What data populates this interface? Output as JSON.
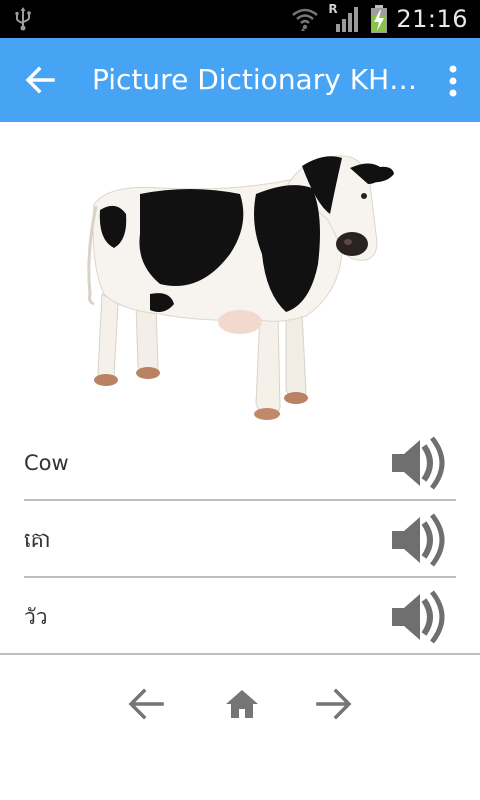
{
  "status_bar": {
    "time": "21:16",
    "icons": [
      "usb-icon",
      "wifi-icon",
      "roaming-indicator",
      "signal-icon",
      "battery-charging-icon"
    ],
    "roaming_label": "R"
  },
  "app_bar": {
    "title": "Picture Dictionary KH En",
    "background_color": "#47a3f3",
    "back_icon": "arrow-left-icon",
    "menu_icon": "more-vertical-icon"
  },
  "picture": {
    "subject": "cow"
  },
  "words": [
    {
      "text": "Cow",
      "icon": "speaker-icon"
    },
    {
      "text": "គោ",
      "icon": "speaker-icon"
    },
    {
      "text": "วัว",
      "icon": "speaker-icon"
    }
  ],
  "bottom_nav": {
    "prev_icon": "arrow-left-icon",
    "home_icon": "home-icon",
    "next_icon": "arrow-right-icon",
    "icon_color": "#757575"
  }
}
